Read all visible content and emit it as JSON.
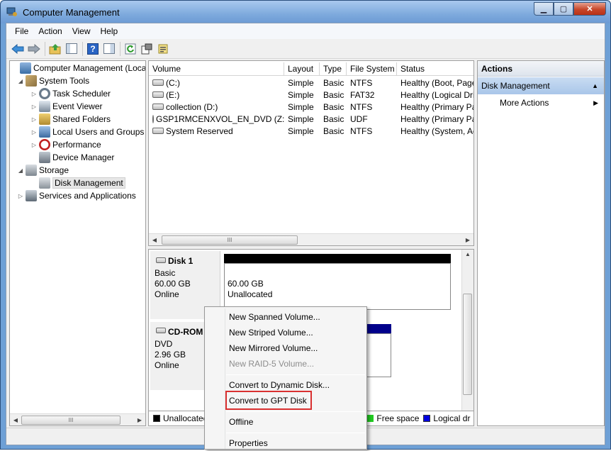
{
  "window": {
    "title": "Computer Management",
    "buttons": {
      "minimize": "▁",
      "maximize": "▢",
      "close": "✕"
    }
  },
  "menubar": [
    "File",
    "Action",
    "View",
    "Help"
  ],
  "toolbar": {
    "icons": [
      "back-icon",
      "forward-icon",
      "up-folder-icon",
      "show-hide-tree-icon",
      "help-icon",
      "show-hide-action-pane-icon",
      "refresh-icon",
      "properties-icon",
      "export-list-icon"
    ]
  },
  "tree": {
    "items": [
      {
        "label": "Computer Management (Local",
        "level": 0,
        "expander": "",
        "icon": "computer-icon"
      },
      {
        "label": "System Tools",
        "level": 1,
        "expander": "◢",
        "icon": "tools-icon"
      },
      {
        "label": "Task Scheduler",
        "level": 2,
        "expander": "▷",
        "icon": "clock-icon"
      },
      {
        "label": "Event Viewer",
        "level": 2,
        "expander": "▷",
        "icon": "event-viewer-icon"
      },
      {
        "label": "Shared Folders",
        "level": 2,
        "expander": "▷",
        "icon": "shared-folder-icon"
      },
      {
        "label": "Local Users and Groups",
        "level": 2,
        "expander": "▷",
        "icon": "users-icon"
      },
      {
        "label": "Performance",
        "level": 2,
        "expander": "▷",
        "icon": "performance-icon"
      },
      {
        "label": "Device Manager",
        "level": 2,
        "expander": "",
        "icon": "device-manager-icon"
      },
      {
        "label": "Storage",
        "level": 1,
        "expander": "◢",
        "icon": "storage-icon"
      },
      {
        "label": "Disk Management",
        "level": 2,
        "expander": "",
        "icon": "disk-management-icon",
        "selected": true
      },
      {
        "label": "Services and Applications",
        "level": 1,
        "expander": "▷",
        "icon": "services-icon"
      }
    ],
    "scroll_thumb": "III"
  },
  "volumes": {
    "columns": [
      "Volume",
      "Layout",
      "Type",
      "File System",
      "Status"
    ],
    "rows": [
      {
        "volume": "(C:)",
        "layout": "Simple",
        "type": "Basic",
        "fs": "NTFS",
        "status": "Healthy (Boot, Page"
      },
      {
        "volume": "(E:)",
        "layout": "Simple",
        "type": "Basic",
        "fs": "FAT32",
        "status": "Healthy (Logical Driv"
      },
      {
        "volume": "collection (D:)",
        "layout": "Simple",
        "type": "Basic",
        "fs": "NTFS",
        "status": "Healthy (Primary Par"
      },
      {
        "volume": "GSP1RMCENXVOL_EN_DVD (Z:)",
        "layout": "Simple",
        "type": "Basic",
        "fs": "UDF",
        "status": "Healthy (Primary Par"
      },
      {
        "volume": "System Reserved",
        "layout": "Simple",
        "type": "Basic",
        "fs": "NTFS",
        "status": "Healthy (System, Ac"
      }
    ],
    "scroll_thumb": "III"
  },
  "disks": [
    {
      "name": "Disk 1",
      "kind": "Basic",
      "size": "60.00 GB",
      "state": "Online",
      "partition_size": "60.00 GB",
      "partition_label": "Unallocated"
    },
    {
      "name": "CD-ROM 0",
      "kind": "DVD",
      "size": "2.96 GB",
      "state": "Online"
    }
  ],
  "legend": [
    {
      "label": "Unallocated",
      "color": "#000000"
    },
    {
      "label": "Free space",
      "color": "#22cc22"
    },
    {
      "label": "Logical dr",
      "color": "#0000e0"
    }
  ],
  "actions": {
    "header": "Actions",
    "section": "Disk Management",
    "section_arrow": "▲",
    "more": "More Actions",
    "more_arrow": "▶"
  },
  "context_menu": [
    {
      "label": "New Spanned Volume...",
      "enabled": true
    },
    {
      "label": "New Striped Volume...",
      "enabled": true
    },
    {
      "label": "New Mirrored Volume...",
      "enabled": true
    },
    {
      "label": "New RAID-5 Volume...",
      "enabled": false
    },
    {
      "label": "Convert to Dynamic Disk...",
      "enabled": true
    },
    {
      "label": "Convert to GPT Disk",
      "enabled": true,
      "highlighted": true
    },
    {
      "label": "Offline",
      "enabled": true
    },
    {
      "label": "Properties",
      "enabled": true
    }
  ],
  "colors": {
    "disk_bar": "#000000",
    "cdrom_bar": "#00008b",
    "highlight": "#d93030"
  }
}
